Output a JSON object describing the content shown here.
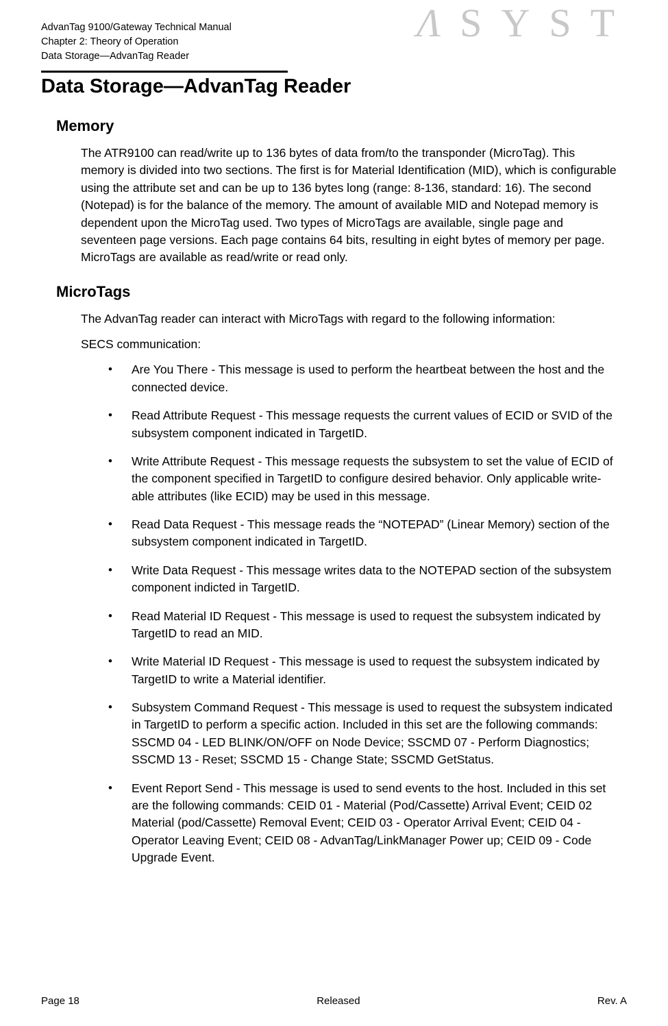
{
  "header": {
    "line1": "AdvanTag 9100/Gateway Technical Manual",
    "line2": "Chapter 2: Theory of Operation",
    "line3": "Data Storage—AdvanTag Reader",
    "logo": "SYST"
  },
  "section": {
    "title": "Data Storage—AdvanTag Reader"
  },
  "memory": {
    "title": "Memory",
    "body": "The ATR9100 can read/write up to 136 bytes of data from/to the transponder (MicroTag). This memory is divided into two sections. The first is for Material Identification (MID), which is configurable using the attribute set and can be up to 136 bytes long (range: 8-136, standard: 16). The second (Notepad) is for the balance of the memory. The amount of available MID and Notepad memory is dependent upon the MicroTag used. Two types of MicroTags are available, single page and seventeen page versions. Each page contains 64 bits, resulting in eight bytes of memory per page. MicroTags are available as read/write or read only."
  },
  "microtags": {
    "title": "MicroTags",
    "intro": "The AdvanTag reader can interact with MicroTags with regard to the following information:",
    "secs_label": "SECS communication:",
    "items": [
      "Are You There - This message is used to perform the heartbeat between the host and the connected device.",
      "Read Attribute Request - This message requests the current values of ECID or SVID of the subsystem component indicated in TargetID.",
      "Write Attribute Request - This message requests the subsystem to set the value of ECID of the component specified in TargetID to configure desired behavior. Only applicable write-able attributes (like ECID) may be used in this message.",
      "Read Data Request - This message reads the “NOTEPAD” (Linear Memory) section of the subsystem component indicated in TargetID.",
      "Write Data Request - This message writes data to the NOTEPAD section of the subsystem component indicted in TargetID.",
      "Read Material ID Request - This message is used to request the subsystem indicated by TargetID to read an MID.",
      "Write Material ID Request - This message is used to request the subsystem indicated by TargetID to write a Material identifier.",
      "Subsystem Command Request - This message is used to request the subsystem indicated in TargetID to perform a specific action. Included in this set are the following commands: SSCMD 04 - LED BLINK/ON/OFF on Node Device; SSCMD 07 - Perform Diagnostics; SSCMD 13 - Reset; SSCMD 15 - Change State; SSCMD GetStatus.",
      "Event Report Send - This message is used to send events to the host. Included in this set are the following commands: CEID 01 - Material (Pod/Cassette) Arrival Event; CEID 02 Material (pod/Cassette) Removal Event; CEID 03 - Operator Arrival Event; CEID 04 - Operator Leaving Event; CEID 08 - AdvanTag/LinkManager Power up; CEID 09 - Code Upgrade Event."
    ]
  },
  "footer": {
    "page": "Page 18",
    "status": "Released",
    "rev": "Rev. A"
  }
}
